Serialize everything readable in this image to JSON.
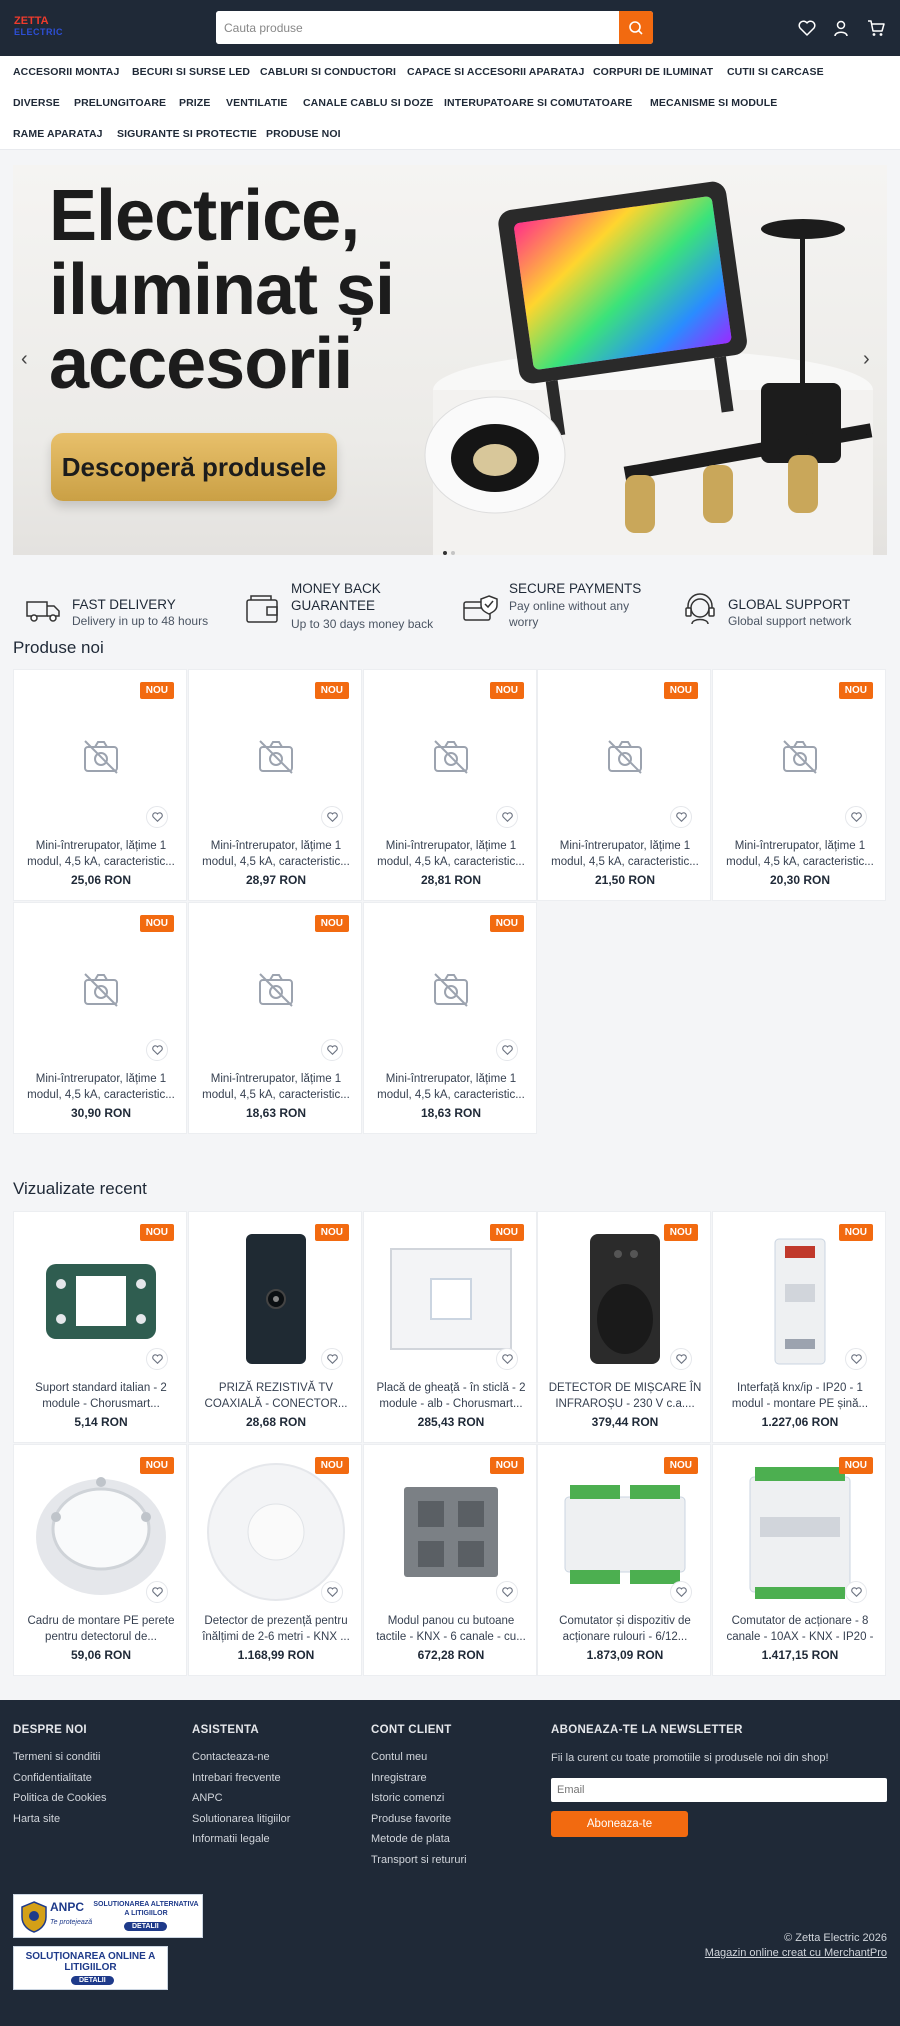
{
  "header": {
    "logo_text": "ZETTA",
    "logo_sub": "ELECTRIC",
    "search_placeholder": "Cauta produse"
  },
  "categories": [
    "ACCESORII MONTAJ",
    "BECURI SI SURSE LED",
    "CABLURI SI CONDUCTORI",
    "CAPACE SI ACCESORII APARATAJ",
    "CORPURI DE ILUMINAT",
    "CUTII SI CARCASE",
    "DIVERSE",
    "PRELUNGITOARE",
    "PRIZE",
    "VENTILATIE",
    "CANALE CABLU SI DOZE",
    "INTERUPATOARE SI COMUTATOARE",
    "MECANISME SI MODULE",
    "RAME APARATAJ",
    "SIGURANTE SI PROTECTIE",
    "PRODUSE NOI"
  ],
  "hero": {
    "title_l1": "Electrice,",
    "title_l2": "iluminat și",
    "title_l3": "accesorii",
    "cta": "Descoperă produsele",
    "prev": "‹",
    "next": "›"
  },
  "features": [
    {
      "icon": "truck-icon",
      "title": "FAST DELIVERY",
      "subtitle": "Delivery in up to 48 hours"
    },
    {
      "icon": "wallet-icon",
      "title": "MONEY BACK GUARANTEE",
      "subtitle": "Up to 30 days money back"
    },
    {
      "icon": "secure-card-icon",
      "title": "SECURE PAYMENTS",
      "subtitle": "Pay online without any worry"
    },
    {
      "icon": "headset-icon",
      "title": "GLOBAL SUPPORT",
      "subtitle": "Global support network"
    }
  ],
  "new_products": {
    "title": "Produse noi",
    "badge": "NOU",
    "items": [
      {
        "name": "Mini-întrerupator, lățime 1 modul, 4,5 kA, caracteristic...",
        "price": "25,06 RON"
      },
      {
        "name": "Mini-întrerupator, lățime 1 modul, 4,5 kA, caracteristic...",
        "price": "28,97 RON"
      },
      {
        "name": "Mini-întrerupator, lățime 1 modul, 4,5 kA, caracteristic...",
        "price": "28,81 RON"
      },
      {
        "name": "Mini-întrerupator, lățime 1 modul, 4,5 kA, caracteristic...",
        "price": "21,50 RON"
      },
      {
        "name": "Mini-întrerupator, lățime 1 modul, 4,5 kA, caracteristic...",
        "price": "20,30 RON"
      },
      {
        "name": "Mini-întrerupator, lățime 1 modul, 4,5 kA, caracteristic...",
        "price": "30,90 RON"
      },
      {
        "name": "Mini-întrerupator, lățime 1 modul, 4,5 kA, caracteristic...",
        "price": "18,63 RON"
      },
      {
        "name": "Mini-întrerupator, lățime 1 modul, 4,5 kA, caracteristic...",
        "price": "18,63 RON"
      }
    ]
  },
  "recent": {
    "title": "Vizualizate recent",
    "badge": "NOU",
    "items": [
      {
        "name": "Suport standard italian - 2 module - Chorusmart...",
        "price": "5,14 RON",
        "img": "bracket"
      },
      {
        "name": "PRIZĂ REZISTIVĂ TV COAXIALĂ - CONECTOR...",
        "price": "28,68 RON",
        "img": "tvsocket"
      },
      {
        "name": "Placă de gheață - în sticlă - 2 module - alb - Chorusmart...",
        "price": "285,43 RON",
        "img": "plate"
      },
      {
        "name": "DETECTOR DE MIȘCARE ÎN INFRAROȘU - 230 V c.a....",
        "price": "379,44 RON",
        "img": "detector"
      },
      {
        "name": "Interfață knx/ip - IP20 - 1 modul - montare PE șină...",
        "price": "1.227,06 RON",
        "img": "dinmodule"
      },
      {
        "name": "Cadru de montare PE perete pentru detectorul de...",
        "price": "59,06 RON",
        "img": "ring"
      },
      {
        "name": "Detector de prezență pentru înălțimi de 2-6 metri - KNX ...",
        "price": "1.168,99 RON",
        "img": "dome"
      },
      {
        "name": "Modul panou cu butoane tactile - KNX - 6 canale - cu...",
        "price": "672,28 RON",
        "img": "panel"
      },
      {
        "name": "Comutator și dispozitiv de acționare rulouri - 6/12...",
        "price": "1.873,09 RON",
        "img": "actuator"
      },
      {
        "name": "Comutator de acționare - 8 canale - 10AX - KNX - IP20 - ...",
        "price": "1.417,15 RON",
        "img": "actuator2"
      }
    ]
  },
  "footer": {
    "col1_title": "DESPRE NOI",
    "col1": [
      "Termeni si conditii",
      "Confidentialitate",
      "Politica de Cookies",
      "Harta site"
    ],
    "col2_title": "ASISTENTA",
    "col2": [
      "Contacteaza-ne",
      "Intrebari frecvente",
      "ANPC",
      "Solutionarea litigiilor",
      "Informatii legale"
    ],
    "col3_title": "CONT CLIENT",
    "col3": [
      "Contul meu",
      "Inregistrare",
      "Istoric comenzi",
      "Produse favorite",
      "Metode de plata",
      "Transport si retururi"
    ],
    "nl_title": "ABONEAZA-TE LA NEWSLETTER",
    "nl_text": "Fii la curent cu toate promotiile si produsele noi din shop!",
    "nl_placeholder": "Email",
    "nl_button": "Aboneaza-te",
    "anpc1_title": "SOLUTIONAREA ALTERNATIVA A LITIGIILOR",
    "anpc1_logo": "ANPC",
    "anpc1_tag": "Te protejează",
    "anpc_detalii": "DETALII",
    "anpc2_title": "SOLUȚIONAREA ONLINE A LITIGIILOR",
    "copyright": "© Zetta Electric 2026",
    "credit": "Magazin online creat cu MerchantPro"
  },
  "colors": {
    "accent": "#f26a10",
    "dark": "#1f2937",
    "bg": "#f4f5f7"
  }
}
